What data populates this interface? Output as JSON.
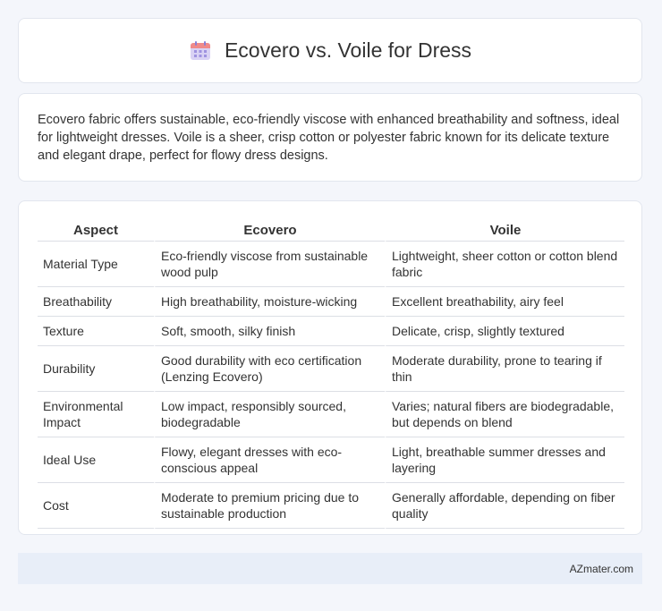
{
  "header": {
    "icon": "calendar-icon",
    "title": "Ecovero vs. Voile for Dress"
  },
  "description": "Ecovero fabric offers sustainable, eco-friendly viscose with enhanced breathability and softness, ideal for lightweight dresses. Voile is a sheer, crisp cotton or polyester fabric known for its delicate texture and elegant drape, perfect for flowy dress designs.",
  "table": {
    "headers": [
      "Aspect",
      "Ecovero",
      "Voile"
    ],
    "rows": [
      [
        "Material Type",
        "Eco-friendly viscose from sustainable wood pulp",
        "Lightweight, sheer cotton or cotton blend fabric"
      ],
      [
        "Breathability",
        "High breathability, moisture-wicking",
        "Excellent breathability, airy feel"
      ],
      [
        "Texture",
        "Soft, smooth, silky finish",
        "Delicate, crisp, slightly textured"
      ],
      [
        "Durability",
        "Good durability with eco certification (Lenzing Ecovero)",
        "Moderate durability, prone to tearing if thin"
      ],
      [
        "Environmental Impact",
        "Low impact, responsibly sourced, biodegradable",
        "Varies; natural fibers are biodegradable, but depends on blend"
      ],
      [
        "Ideal Use",
        "Flowy, elegant dresses with eco-conscious appeal",
        "Light, breathable summer dresses and layering"
      ],
      [
        "Cost",
        "Moderate to premium pricing due to sustainable production",
        "Generally affordable, depending on fiber quality"
      ]
    ]
  },
  "footer": {
    "brand": "AZmater.com"
  }
}
